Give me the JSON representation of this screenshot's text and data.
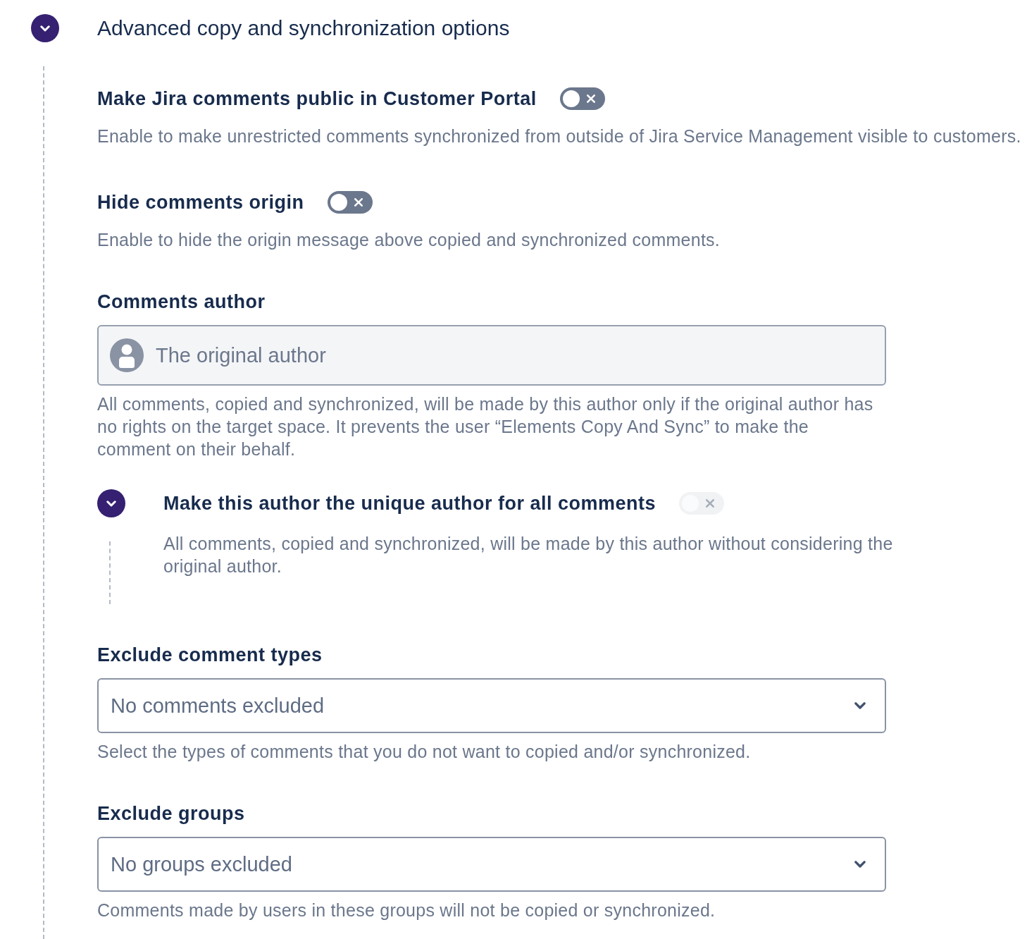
{
  "section": {
    "title": "Advanced copy and synchronization options",
    "expanded": true,
    "settings": [
      {
        "kind": "toggle",
        "label": "Make Jira comments public in Customer Portal",
        "on": false,
        "disabled": false,
        "description": "Enable to make unrestricted comments synchronized from outside of Jira Service Management visible to customers."
      },
      {
        "kind": "toggle",
        "label": "Hide comments origin",
        "on": false,
        "disabled": false,
        "description": "Enable to hide the origin message above copied and synchronized comments."
      },
      {
        "kind": "user_picker",
        "label": "Comments author",
        "value": "The original author",
        "disabled": true,
        "description": "All comments, copied and synchronized, will be made by this author only if the original author has no rights on the target space. It prevents the user “Elements Copy And Sync” to make the comment on their behalf.",
        "subsection": {
          "title": "Make this author the unique author for all comments",
          "expanded": true,
          "toggle": {
            "on": false,
            "disabled": true
          },
          "description": "All comments, copied and synchronized, will be made by this author without considering the original author."
        }
      },
      {
        "kind": "select",
        "label": "Exclude comment types",
        "placeholder": "No comments excluded",
        "description": "Select the types of comments that you do not want to copied and/or synchronized."
      },
      {
        "kind": "select",
        "label": "Exclude groups",
        "placeholder": "No groups excluded",
        "description": "Comments made by users in these groups will not be copied or synchronized."
      }
    ]
  }
}
